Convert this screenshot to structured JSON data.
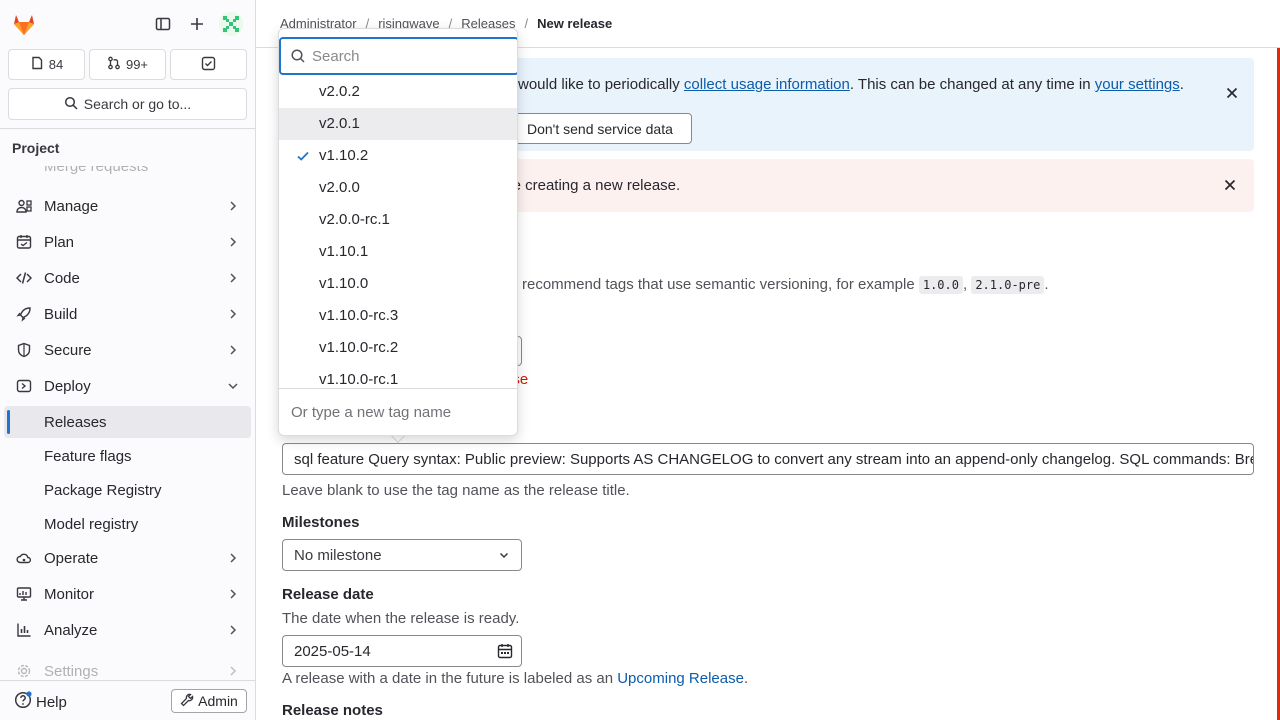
{
  "sidebar": {
    "counts": {
      "issues": "84",
      "merge_requests": "99+"
    },
    "search_label": "Search or go to...",
    "project_heading": "Project",
    "partial_item": "Merge requests",
    "items": [
      {
        "label": "Manage",
        "icon": "users-icon"
      },
      {
        "label": "Plan",
        "icon": "planning-icon"
      },
      {
        "label": "Code",
        "icon": "code-icon"
      },
      {
        "label": "Build",
        "icon": "rocket-icon"
      },
      {
        "label": "Secure",
        "icon": "shield-icon"
      },
      {
        "label": "Deploy",
        "icon": "deployments-icon"
      }
    ],
    "deploy_sub": [
      "Releases",
      "Feature flags",
      "Package Registry",
      "Model registry"
    ],
    "items2": [
      {
        "label": "Operate",
        "icon": "cloud-gear-icon"
      },
      {
        "label": "Monitor",
        "icon": "monitor-icon"
      },
      {
        "label": "Analyze",
        "icon": "chart-icon"
      }
    ],
    "settings_label": "Settings",
    "help_label": "Help",
    "admin_label": "Admin"
  },
  "breadcrumb": [
    "Administrator",
    "risingwave",
    "Releases",
    "New release"
  ],
  "info_alert": {
    "text_start": "would like to periodically ",
    "link1": "collect usage information",
    "text_mid": ". This can be changed at any time in ",
    "link2": "your settings",
    "text_end": ".",
    "button": "Don't send service data"
  },
  "error_alert": {
    "text": "Something went wrong while creating a new release."
  },
  "tag_help": {
    "text": "recommend tags that use semantic versioning, for example ",
    "ex1": "1.0.0",
    "sep": ", ",
    "ex2": "2.1.0-pre",
    "end": "."
  },
  "tag_error_tail": "ose",
  "release_title": {
    "value": "sql feature Query syntax: Public preview: Supports AS CHANGELOG to convert any stream into an append-only changelog. SQL commands: Breaking change: DEFAULT in ALTER TABLE",
    "help": "Leave blank to use the tag name as the release title."
  },
  "milestones": {
    "label": "Milestones",
    "value": "No milestone"
  },
  "release_date": {
    "label": "Release date",
    "desc": "The date when the release is ready.",
    "value": "2025-05-14",
    "help_start": "A release with a date in the future is labeled as an ",
    "help_link": "Upcoming Release",
    "help_end": "."
  },
  "release_notes_label": "Release notes",
  "tag_dropdown": {
    "search_placeholder": "Search",
    "items": [
      "v2.0.2",
      "v2.0.1",
      "v1.10.2",
      "v2.0.0",
      "v2.0.0-rc.1",
      "v1.10.1",
      "v1.10.0",
      "v1.10.0-rc.3",
      "v1.10.0-rc.2",
      "v1.10.0-rc.1"
    ],
    "selected": "v1.10.2",
    "highlighted": "v2.0.1",
    "footer": "Or type a new tag name"
  }
}
